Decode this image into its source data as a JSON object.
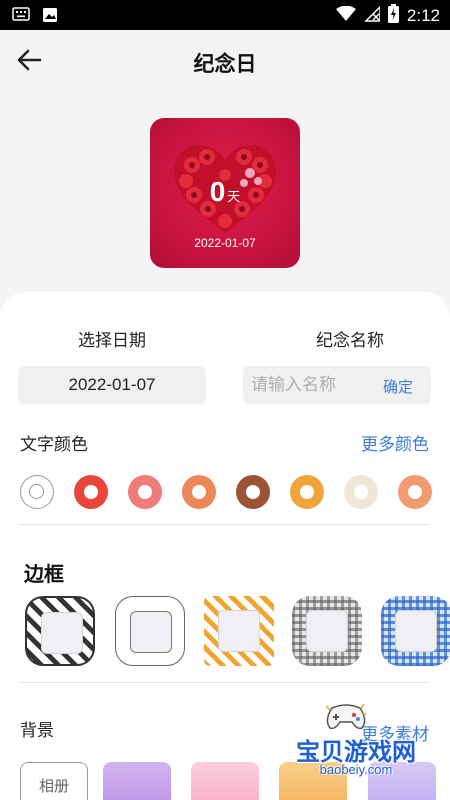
{
  "status_bar": {
    "time": "2:12",
    "icons": [
      "keyboard-icon",
      "image-icon",
      "wifi-icon",
      "signal-icon",
      "battery-icon"
    ]
  },
  "header": {
    "title": "纪念日",
    "back_icon": "arrow-left-icon"
  },
  "preview": {
    "count": "0",
    "unit": "天",
    "date": "2022-01-07",
    "background": "red-rose-heart"
  },
  "form": {
    "date_label": "选择日期",
    "date_value": "2022-01-07",
    "name_label": "纪念名称",
    "name_placeholder": "请输入名称",
    "confirm": "确定"
  },
  "text_color": {
    "label": "文字颜色",
    "more": "更多颜色",
    "swatches": [
      "#ffffff",
      "#e8453c",
      "#ef7b7b",
      "#ec8758",
      "#9a5334",
      "#f0a53a",
      "#efe7d6",
      "#f19a6f"
    ]
  },
  "border": {
    "title": "边框",
    "styles": [
      "diagonal-stripe-black",
      "plain-outline",
      "diagonal-stripe-orange",
      "plaid-gray",
      "gingham-blue"
    ]
  },
  "background": {
    "label": "背景",
    "more": "更多素材",
    "album": "相册",
    "thumbs": [
      "#caa7e8",
      "#f8b7cc",
      "#f7c070",
      "#c9b8f2"
    ]
  },
  "watermark": {
    "text": "宝贝游戏网",
    "url": "baobeiy.com"
  },
  "colors": {
    "accent": "#3d7be0"
  }
}
